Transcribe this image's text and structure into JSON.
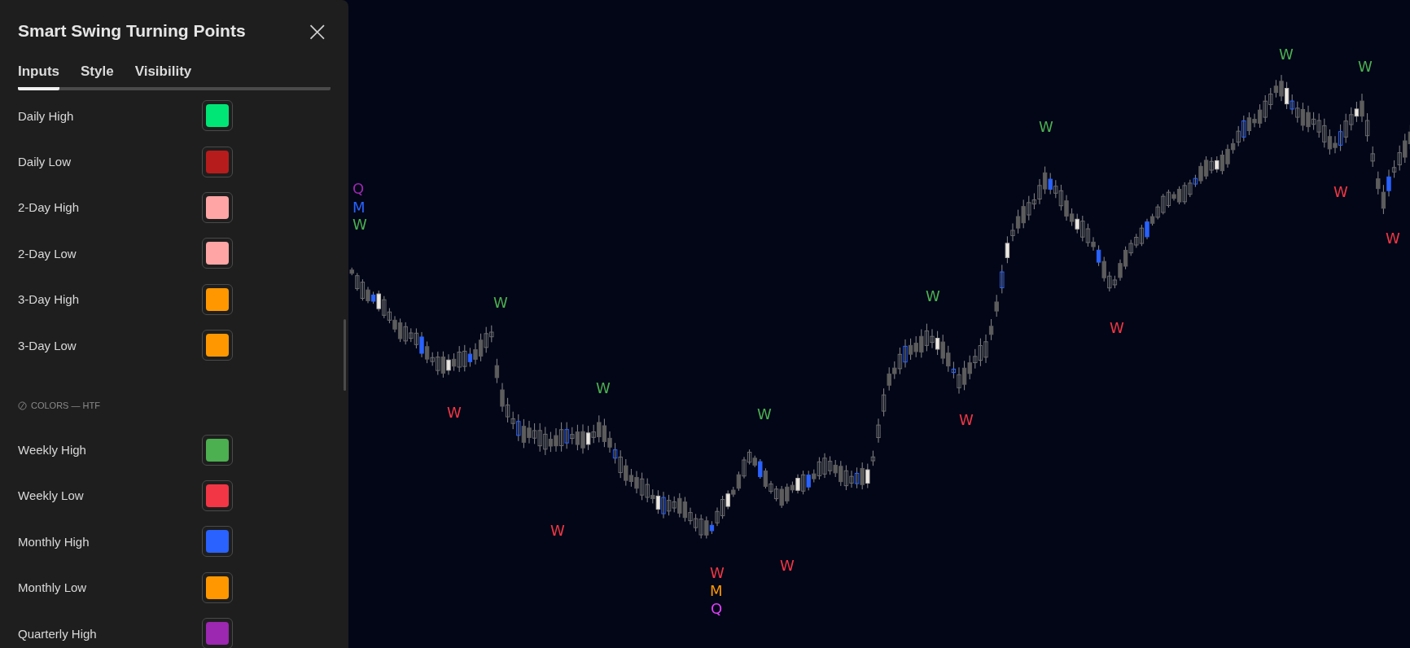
{
  "panel": {
    "title": "Smart Swing Turning Points",
    "close": "×",
    "tabs": [
      {
        "label": "Inputs",
        "selected": true
      },
      {
        "label": "Style",
        "selected": false
      },
      {
        "label": "Visibility",
        "selected": false
      }
    ],
    "groups": [
      {
        "rows": [
          {
            "label": "Daily High",
            "color": "#00e676"
          },
          {
            "label": "Daily Low",
            "color": "#b71c1c"
          },
          {
            "label": "2-Day High",
            "color": "#ffa5a5"
          },
          {
            "label": "2-Day Low",
            "color": "#ffa5a5"
          },
          {
            "label": "3-Day High",
            "color": "#ff9800"
          },
          {
            "label": "3-Day Low",
            "color": "#ff9800"
          }
        ]
      },
      {
        "header": "COLORS — HTF",
        "rows": [
          {
            "label": "Weekly High",
            "color": "#4caf50"
          },
          {
            "label": "Weekly Low",
            "color": "#f23645"
          },
          {
            "label": "Monthly High",
            "color": "#2962ff"
          },
          {
            "label": "Monthly Low",
            "color": "#ff9800"
          },
          {
            "label": "Quarterly High",
            "color": "#9c27b0"
          }
        ]
      }
    ]
  },
  "chart": {
    "labels": [
      {
        "text": "Q",
        "color": "#9c27b0"
      },
      {
        "text": "M",
        "color": "#2962ff"
      },
      {
        "text": "W",
        "color": "#4caf50"
      },
      {
        "text": "W",
        "color": "#4caf50"
      },
      {
        "text": "W",
        "color": "#f23645"
      },
      {
        "text": "W",
        "color": "#4caf50"
      },
      {
        "text": "W",
        "color": "#4caf50"
      },
      {
        "text": "W",
        "color": "#f23645"
      },
      {
        "text": "W",
        "color": "#f23645"
      },
      {
        "text": "M",
        "color": "#ff9800"
      },
      {
        "text": "Q",
        "color": "#e040fb"
      },
      {
        "text": "W",
        "color": "#f23645"
      },
      {
        "text": "W",
        "color": "#4caf50"
      },
      {
        "text": "W",
        "color": "#f23645"
      },
      {
        "text": "W",
        "color": "#4caf50"
      },
      {
        "text": "W",
        "color": "#f23645"
      },
      {
        "text": "W",
        "color": "#4caf50"
      },
      {
        "text": "W",
        "color": "#4caf50"
      },
      {
        "text": "W",
        "color": "#f23645"
      },
      {
        "text": "W",
        "color": "#f23645"
      }
    ]
  }
}
